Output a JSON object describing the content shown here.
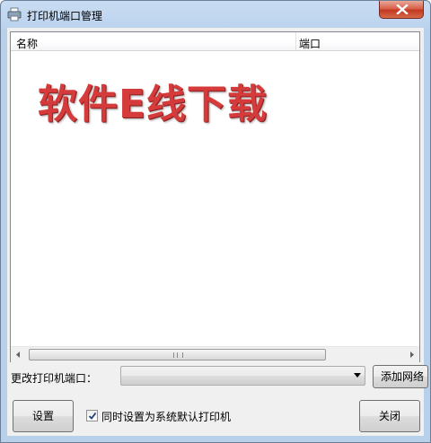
{
  "window": {
    "title": "打印机端口管理"
  },
  "list": {
    "columns": [
      "名称",
      "端口"
    ],
    "watermark": "软件E线下载"
  },
  "port": {
    "label": "更改打印机端口：",
    "selected": "",
    "add_button": "添加网络"
  },
  "footer": {
    "set_button": "设置",
    "default_checkbox_label": "同时设置为系统默认打印机",
    "default_checkbox_checked": true,
    "close_button": "关闭"
  },
  "colors": {
    "titlebar": "#bcd3ee",
    "close_red": "#c3381f",
    "watermark": "#d63b3b",
    "dialog_bg": "#f0f0f0"
  },
  "icons": {
    "app": "printer-icon",
    "close": "close-icon",
    "scroll_left": "arrow-left-icon",
    "scroll_right": "arrow-right-icon",
    "dropdown": "chevron-down-icon",
    "check": "checkmark-icon"
  }
}
